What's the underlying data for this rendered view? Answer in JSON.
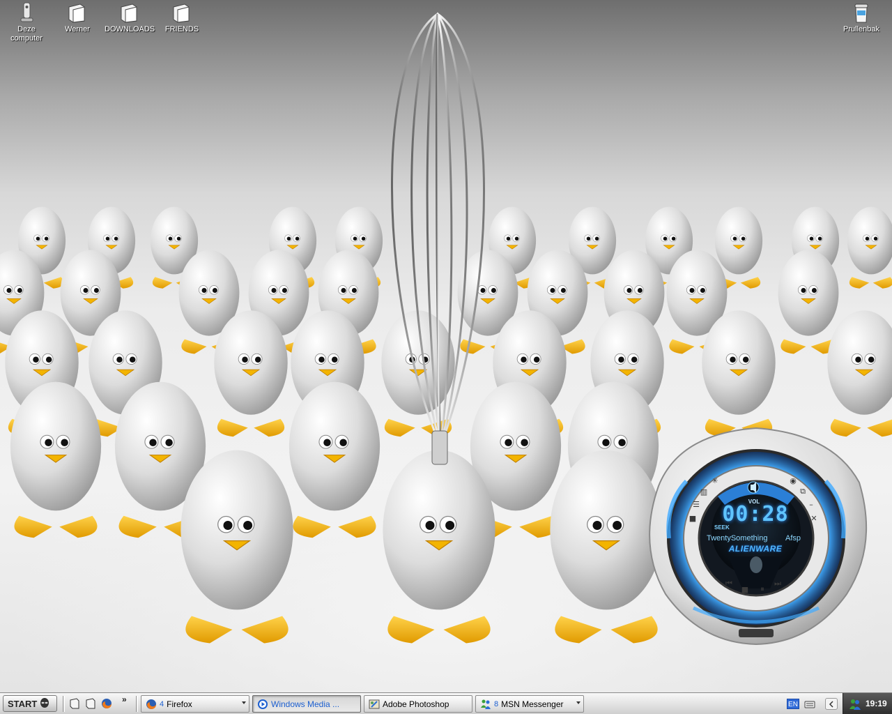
{
  "desktop": {
    "icons": [
      {
        "name": "my-computer-icon",
        "label": "Deze\ncomputer"
      },
      {
        "name": "folder-icon",
        "label": "Werner"
      },
      {
        "name": "folder-icon",
        "label": "DOWNLOADS"
      },
      {
        "name": "folder-icon",
        "label": "FRIENDS"
      },
      {
        "name": "recycle-bin-icon",
        "label": "Prullenbak"
      }
    ]
  },
  "media_player": {
    "vol_label": "VOL",
    "time": "00:28",
    "seek_label": "SEEK",
    "track": "TwentySomething",
    "mode": "Afsp",
    "brand": "ALIENWARE",
    "accent": "#3fa9ff"
  },
  "taskbar": {
    "start_label": "START",
    "quick_launch": [
      "show-desktop-icon",
      "folder-icon",
      "firefox-icon"
    ],
    "quick_launch_more": "»",
    "buttons": [
      {
        "count": "4",
        "label": "Firefox",
        "icon": "firefox-icon",
        "active": false
      },
      {
        "count": "",
        "label": "Windows Media ...",
        "icon": "windows-media-player-icon",
        "active": true
      },
      {
        "count": "",
        "label": "Adobe Photoshop",
        "icon": "photoshop-icon",
        "active": false
      },
      {
        "count": "8",
        "label": "MSN Messenger",
        "icon": "msn-messenger-icon",
        "active": false
      }
    ],
    "language": "EN",
    "clock": "19:19"
  }
}
